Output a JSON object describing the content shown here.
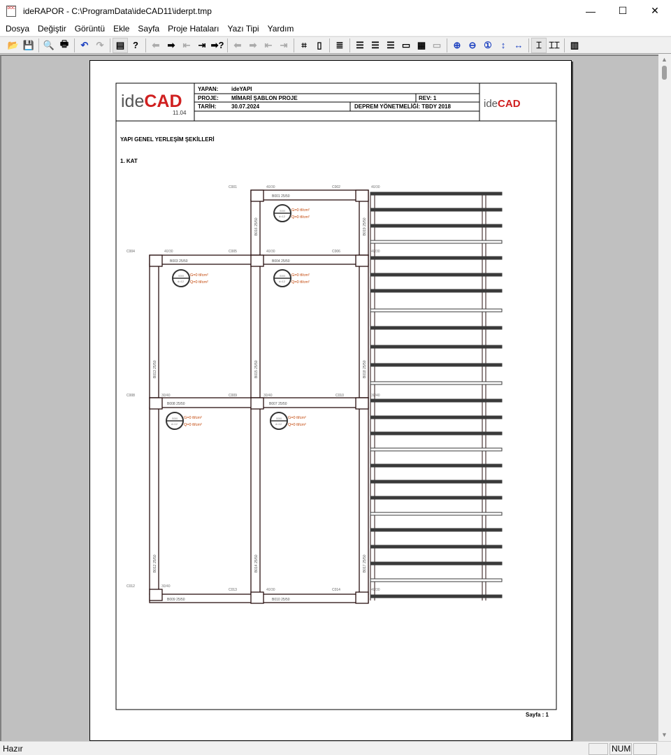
{
  "window": {
    "title": "ideRAPOR - C:\\ProgramData\\ideCAD11\\iderpt.tmp",
    "minimize": "—",
    "maximize": "☐",
    "close": "✕"
  },
  "menu": [
    "Dosya",
    "Değiştir",
    "Görüntü",
    "Ekle",
    "Sayfa",
    "Proje Hataları",
    "Yazı Tipi",
    "Yardım"
  ],
  "toolbar": [
    {
      "icon": "open-folder-icon",
      "glyph": "📂"
    },
    {
      "icon": "save-icon",
      "glyph": "💾",
      "disabled": true
    },
    null,
    {
      "icon": "print-preview-icon",
      "glyph": "🔍"
    },
    {
      "icon": "print-icon",
      "glyph": "🖶"
    },
    null,
    {
      "icon": "undo-icon",
      "glyph": "↶"
    },
    {
      "icon": "redo-icon",
      "glyph": "↷",
      "disabled": true
    },
    null,
    {
      "icon": "report-list-icon",
      "glyph": "▤",
      "active": true
    },
    {
      "icon": "help-doc-icon",
      "glyph": "?"
    },
    null,
    {
      "icon": "prev-icon",
      "glyph": "⬅",
      "disabled": true
    },
    {
      "icon": "next-icon",
      "glyph": "➡"
    },
    {
      "icon": "first-icon",
      "glyph": "⇤",
      "disabled": true
    },
    {
      "icon": "last-icon",
      "glyph": "⇥"
    },
    {
      "icon": "goto-icon",
      "glyph": "➡?"
    },
    null,
    {
      "icon": "prev-error-icon",
      "glyph": "⬅",
      "disabled": true
    },
    {
      "icon": "next-error-icon",
      "glyph": "➡",
      "disabled": true
    },
    {
      "icon": "first-error-icon",
      "glyph": "⇤",
      "disabled": true
    },
    {
      "icon": "last-error-icon",
      "glyph": "⇥",
      "disabled": true
    },
    null,
    {
      "icon": "page-setup-icon",
      "glyph": "⌗"
    },
    {
      "icon": "page-break-icon",
      "glyph": "▯"
    },
    null,
    {
      "icon": "numbering-icon",
      "glyph": "≣"
    },
    null,
    {
      "icon": "header-icon",
      "glyph": "☰"
    },
    {
      "icon": "left-margin-icon",
      "glyph": "☰"
    },
    {
      "icon": "right-margin-icon",
      "glyph": "☰"
    },
    {
      "icon": "top-margin-icon",
      "glyph": "▭"
    },
    {
      "icon": "grid-icon",
      "glyph": "▦"
    },
    {
      "icon": "step-icon",
      "glyph": "▭",
      "disabled": true
    },
    null,
    {
      "icon": "zoom-in-icon",
      "glyph": "⊕"
    },
    {
      "icon": "zoom-out-icon",
      "glyph": "⊖"
    },
    {
      "icon": "zoom-actual-icon",
      "glyph": "①"
    },
    {
      "icon": "fit-height-icon",
      "glyph": "↕"
    },
    {
      "icon": "fit-width-icon",
      "glyph": "↔"
    },
    null,
    {
      "icon": "single-page-icon",
      "glyph": "⌶",
      "active": true
    },
    {
      "icon": "two-page-icon",
      "glyph": "⌶⌶"
    },
    null,
    {
      "icon": "table-icon",
      "glyph": "▥"
    }
  ],
  "header": {
    "logo_text": "ideCAD",
    "version": "11.04",
    "yapan_label": "YAPAN:",
    "yapan": "ideYAPI",
    "proje_label": "PROJE:",
    "proje": "MİMARİ ŞABLON PROJE",
    "rev": "REV: 1",
    "tarih_label": "TARİH:",
    "tarih": "30.07.2024",
    "deprem": "DEPREM YÖNETMELİĞİ: TBDY 2018",
    "logo_right": "ideCAD"
  },
  "section_title": "YAPI GENEL YERLEŞİM ŞEKİLLERİ",
  "floor_title": "1. KAT",
  "plan": {
    "columns": [
      "C001",
      "C002",
      "C004",
      "C005",
      "C006",
      "C008",
      "C009",
      "C010",
      "C012",
      "C013",
      "C014"
    ],
    "column_sizes": [
      "40/30",
      "40/30",
      "40/30",
      "40/30",
      "40/30",
      "30/40",
      "30/40",
      "30/40",
      "30/40",
      "40/30",
      "40/30"
    ],
    "beams": [
      "B001  25/50",
      "B003  25/50",
      "B004  25/50",
      "B008  25/50",
      "B007  25/50",
      "B009  25/50",
      "B010  25/50",
      "B016  25/50",
      "B019  25/50",
      "B013  25/50",
      "B015  25/50",
      "B018  25/50",
      "B012  25/50",
      "B014  25/50",
      "B017  25/50"
    ],
    "slab": {
      "id": "S000",
      "d": "d=12",
      "g": "G=0 tf/cm²",
      "q": "Q=0 tf/cm²"
    }
  },
  "footer": {
    "page": "Sayfa : 1"
  },
  "status": {
    "text": "Hazır",
    "num": "NUM"
  },
  "colors": {
    "column_label": "#b03030",
    "beam_label": "#2a4a8a",
    "slab_load": "#c04000",
    "frame": "#2a1010"
  }
}
